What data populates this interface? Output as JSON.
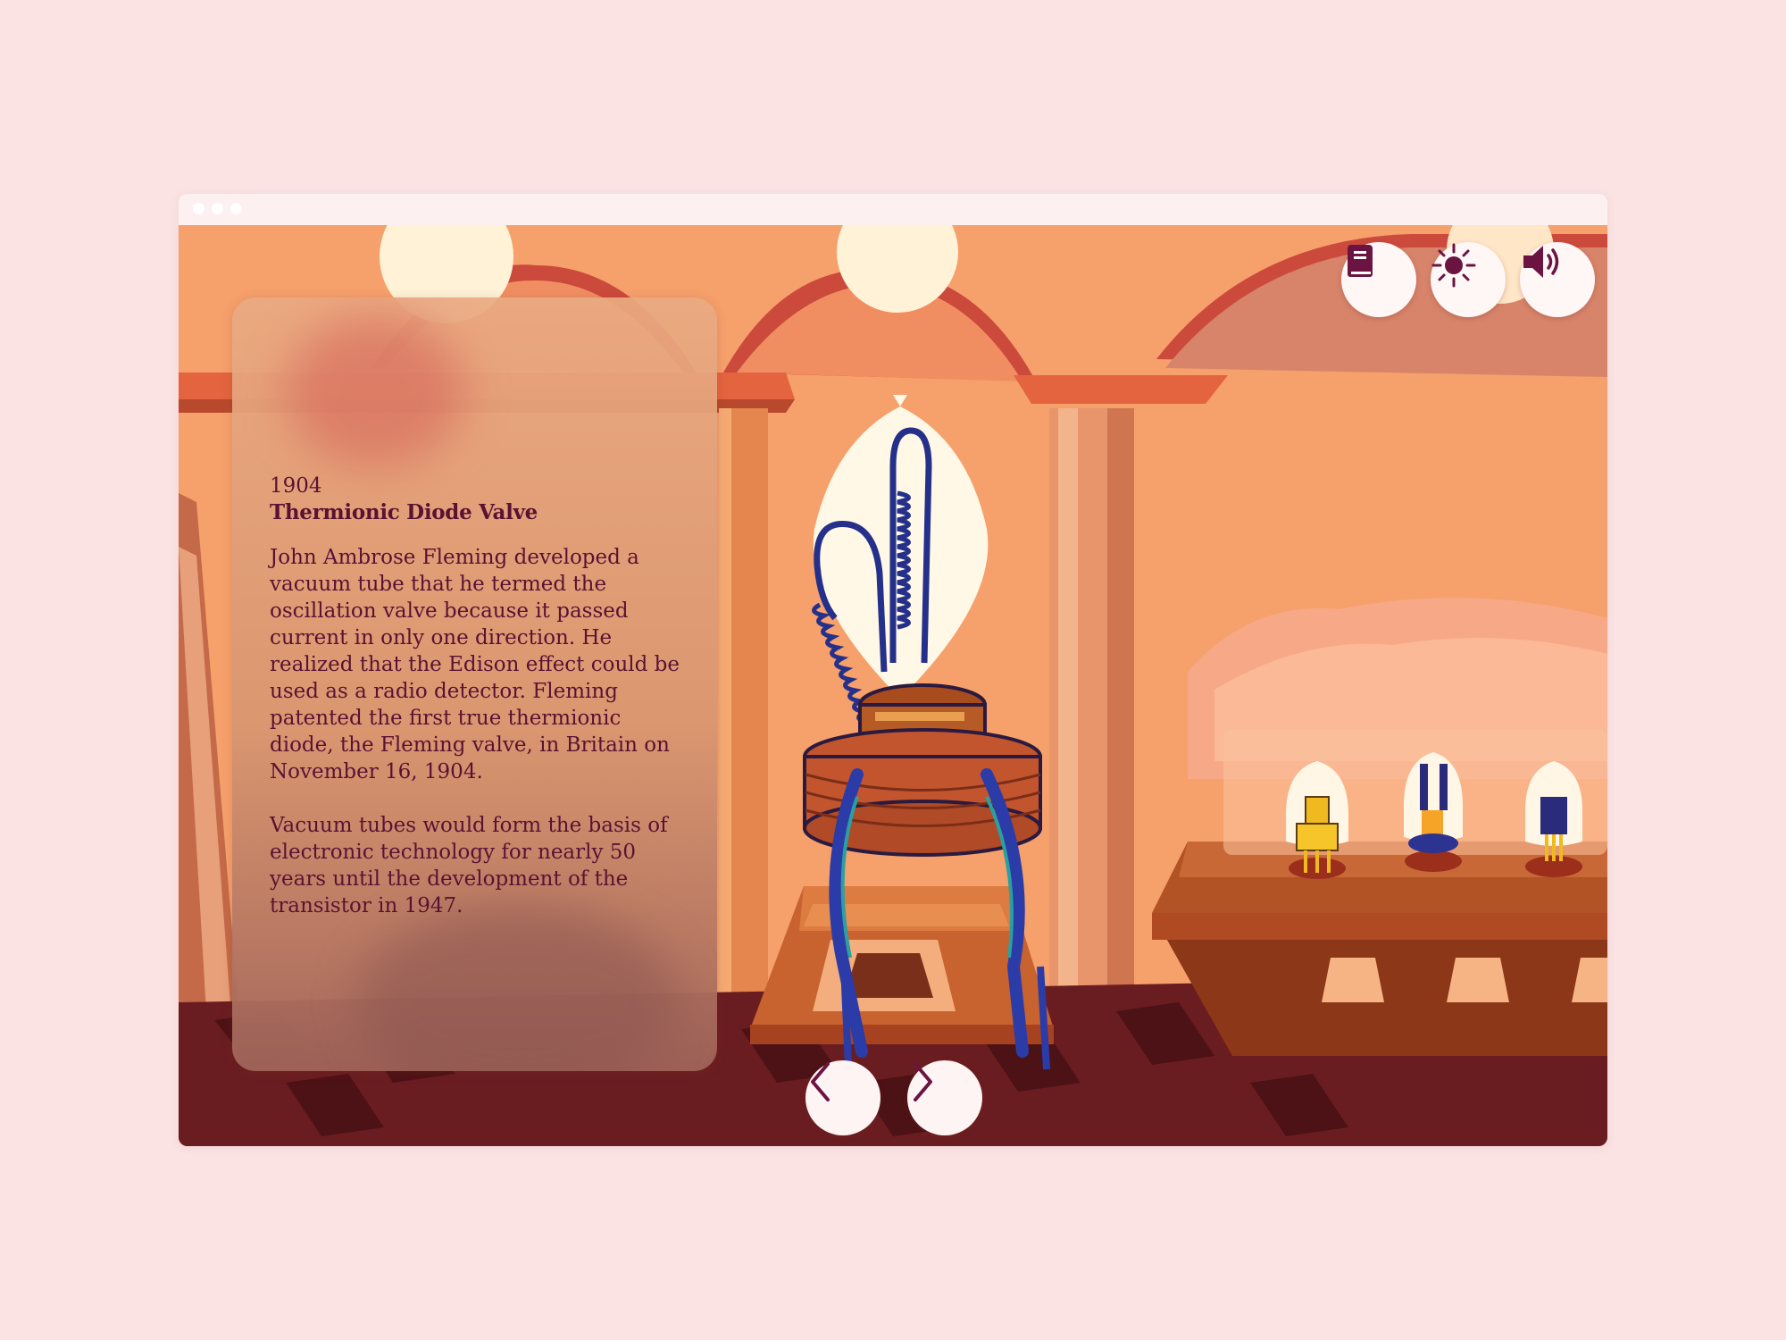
{
  "window": {
    "controls": [
      "close-dot",
      "minimize-dot",
      "maximize-dot"
    ]
  },
  "toolbar": {
    "buttons": [
      {
        "name": "book-icon",
        "action": "encyclopedia"
      },
      {
        "name": "sun-icon",
        "action": "brightness"
      },
      {
        "name": "speaker-icon",
        "action": "sound"
      }
    ]
  },
  "info_card": {
    "year": "1904",
    "title": "Thermionic Diode Valve",
    "paragraphs": [
      "John Ambrose Fleming developed a vacuum tube that he termed the oscillation valve because it passed current in only one direction. He realized that the Edison effect could be used as a radio detector. Fleming patented the first true thermionic diode, the Fleming valve, in Britain on November 16, 1904.",
      "Vacuum tubes would form the basis of electronic technology for nearly 50 years until the development of the transistor in 1947."
    ]
  },
  "navigation": {
    "prev_icon": "chevron-left-icon",
    "next_icon": "chevron-right-icon"
  },
  "colors": {
    "page_background": "#fbe3e3",
    "scene_wall": "#f6a06c",
    "text": "#5a1233",
    "icon": "#6b1442",
    "button_background": "#fff7f6",
    "wire": "#25308a",
    "base": "#c2552e"
  }
}
